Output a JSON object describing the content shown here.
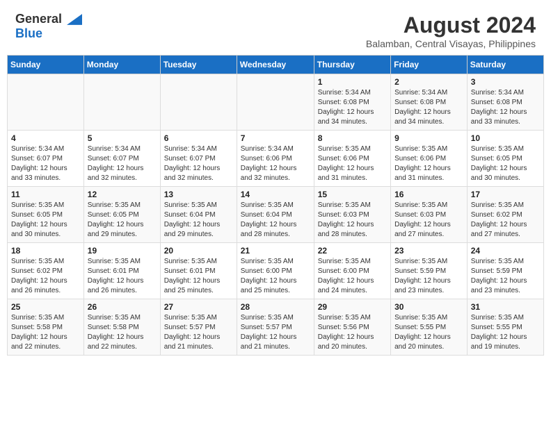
{
  "header": {
    "logo_line1": "General",
    "logo_line2": "Blue",
    "month_year": "August 2024",
    "location": "Balamban, Central Visayas, Philippines"
  },
  "weekdays": [
    "Sunday",
    "Monday",
    "Tuesday",
    "Wednesday",
    "Thursday",
    "Friday",
    "Saturday"
  ],
  "weeks": [
    [
      {
        "day": "",
        "sunrise": "",
        "sunset": "",
        "daylight": ""
      },
      {
        "day": "",
        "sunrise": "",
        "sunset": "",
        "daylight": ""
      },
      {
        "day": "",
        "sunrise": "",
        "sunset": "",
        "daylight": ""
      },
      {
        "day": "",
        "sunrise": "",
        "sunset": "",
        "daylight": ""
      },
      {
        "day": "1",
        "sunrise": "5:34 AM",
        "sunset": "6:08 PM",
        "daylight": "12 hours and 34 minutes."
      },
      {
        "day": "2",
        "sunrise": "5:34 AM",
        "sunset": "6:08 PM",
        "daylight": "12 hours and 34 minutes."
      },
      {
        "day": "3",
        "sunrise": "5:34 AM",
        "sunset": "6:08 PM",
        "daylight": "12 hours and 33 minutes."
      }
    ],
    [
      {
        "day": "4",
        "sunrise": "5:34 AM",
        "sunset": "6:07 PM",
        "daylight": "12 hours and 33 minutes."
      },
      {
        "day": "5",
        "sunrise": "5:34 AM",
        "sunset": "6:07 PM",
        "daylight": "12 hours and 32 minutes."
      },
      {
        "day": "6",
        "sunrise": "5:34 AM",
        "sunset": "6:07 PM",
        "daylight": "12 hours and 32 minutes."
      },
      {
        "day": "7",
        "sunrise": "5:34 AM",
        "sunset": "6:06 PM",
        "daylight": "12 hours and 32 minutes."
      },
      {
        "day": "8",
        "sunrise": "5:35 AM",
        "sunset": "6:06 PM",
        "daylight": "12 hours and 31 minutes."
      },
      {
        "day": "9",
        "sunrise": "5:35 AM",
        "sunset": "6:06 PM",
        "daylight": "12 hours and 31 minutes."
      },
      {
        "day": "10",
        "sunrise": "5:35 AM",
        "sunset": "6:05 PM",
        "daylight": "12 hours and 30 minutes."
      }
    ],
    [
      {
        "day": "11",
        "sunrise": "5:35 AM",
        "sunset": "6:05 PM",
        "daylight": "12 hours and 30 minutes."
      },
      {
        "day": "12",
        "sunrise": "5:35 AM",
        "sunset": "6:05 PM",
        "daylight": "12 hours and 29 minutes."
      },
      {
        "day": "13",
        "sunrise": "5:35 AM",
        "sunset": "6:04 PM",
        "daylight": "12 hours and 29 minutes."
      },
      {
        "day": "14",
        "sunrise": "5:35 AM",
        "sunset": "6:04 PM",
        "daylight": "12 hours and 28 minutes."
      },
      {
        "day": "15",
        "sunrise": "5:35 AM",
        "sunset": "6:03 PM",
        "daylight": "12 hours and 28 minutes."
      },
      {
        "day": "16",
        "sunrise": "5:35 AM",
        "sunset": "6:03 PM",
        "daylight": "12 hours and 27 minutes."
      },
      {
        "day": "17",
        "sunrise": "5:35 AM",
        "sunset": "6:02 PM",
        "daylight": "12 hours and 27 minutes."
      }
    ],
    [
      {
        "day": "18",
        "sunrise": "5:35 AM",
        "sunset": "6:02 PM",
        "daylight": "12 hours and 26 minutes."
      },
      {
        "day": "19",
        "sunrise": "5:35 AM",
        "sunset": "6:01 PM",
        "daylight": "12 hours and 26 minutes."
      },
      {
        "day": "20",
        "sunrise": "5:35 AM",
        "sunset": "6:01 PM",
        "daylight": "12 hours and 25 minutes."
      },
      {
        "day": "21",
        "sunrise": "5:35 AM",
        "sunset": "6:00 PM",
        "daylight": "12 hours and 25 minutes."
      },
      {
        "day": "22",
        "sunrise": "5:35 AM",
        "sunset": "6:00 PM",
        "daylight": "12 hours and 24 minutes."
      },
      {
        "day": "23",
        "sunrise": "5:35 AM",
        "sunset": "5:59 PM",
        "daylight": "12 hours and 23 minutes."
      },
      {
        "day": "24",
        "sunrise": "5:35 AM",
        "sunset": "5:59 PM",
        "daylight": "12 hours and 23 minutes."
      }
    ],
    [
      {
        "day": "25",
        "sunrise": "5:35 AM",
        "sunset": "5:58 PM",
        "daylight": "12 hours and 22 minutes."
      },
      {
        "day": "26",
        "sunrise": "5:35 AM",
        "sunset": "5:58 PM",
        "daylight": "12 hours and 22 minutes."
      },
      {
        "day": "27",
        "sunrise": "5:35 AM",
        "sunset": "5:57 PM",
        "daylight": "12 hours and 21 minutes."
      },
      {
        "day": "28",
        "sunrise": "5:35 AM",
        "sunset": "5:57 PM",
        "daylight": "12 hours and 21 minutes."
      },
      {
        "day": "29",
        "sunrise": "5:35 AM",
        "sunset": "5:56 PM",
        "daylight": "12 hours and 20 minutes."
      },
      {
        "day": "30",
        "sunrise": "5:35 AM",
        "sunset": "5:55 PM",
        "daylight": "12 hours and 20 minutes."
      },
      {
        "day": "31",
        "sunrise": "5:35 AM",
        "sunset": "5:55 PM",
        "daylight": "12 hours and 19 minutes."
      }
    ]
  ]
}
